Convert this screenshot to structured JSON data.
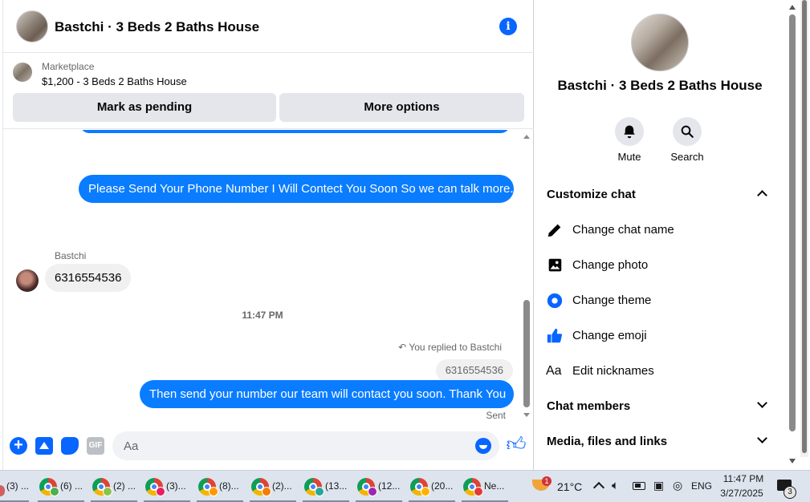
{
  "chat": {
    "title": "Bastchi · 3 Beds 2 Baths House",
    "marketplace": {
      "label": "Marketplace",
      "listing": "$1,200 - 3 Beds 2 Baths House",
      "mark_pending": "Mark as pending",
      "more_options": "More options"
    },
    "messages": {
      "outgoing_1": "Please Send Your Phone Number I Will Contect You Soon So we can talk more.",
      "sender_name": "Bastchi",
      "incoming_1": "6316554536",
      "timestamp": "11:47 PM",
      "reply_note": "You replied to Bastchi",
      "reply_quote": "6316554536",
      "outgoing_2": "Then send your number our team will contact you soon. Thank You",
      "status": "Sent"
    },
    "composer": {
      "placeholder": "Aa",
      "gif_label": "GIF"
    }
  },
  "panel": {
    "title": "Bastchi · 3 Beds 2 Baths House",
    "mute": "Mute",
    "search": "Search",
    "customize": "Customize chat",
    "change_name": "Change chat name",
    "change_photo": "Change photo",
    "change_theme": "Change theme",
    "change_emoji": "Change emoji",
    "nickname_icon": "Aa",
    "edit_nicknames": "Edit nicknames",
    "members": "Chat members",
    "media": "Media, files and links"
  },
  "taskbar": {
    "items": [
      "(3) ...",
      "(6) ...",
      "(2) ...",
      "(3)...",
      "(8)...",
      "(2)...",
      "(13...",
      "(12...",
      "(20...",
      "Ne..."
    ],
    "weather_badge": "1",
    "temperature": "21°C",
    "language": "ENG",
    "time": "11:47 PM",
    "date": "3/27/2025",
    "notifications": "3"
  },
  "colors": {
    "accent": "#0866ff",
    "bubble_out": "#0a7cff",
    "bubble_in": "#f0f0f0",
    "taskbar": "#dde4ee"
  }
}
